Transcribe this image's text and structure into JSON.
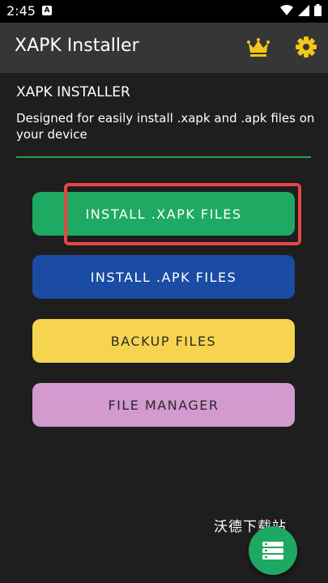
{
  "status_bar": {
    "time": "2:45",
    "notification_icon": "a-badge-icon",
    "icons": [
      "wifi-icon",
      "signal-icon",
      "battery-icon"
    ]
  },
  "app_bar": {
    "title": "XAPK Installer",
    "crown_icon": "crown-icon",
    "settings_icon": "gear-icon"
  },
  "main": {
    "heading": "XAPK INSTALLER",
    "description": "Designed for easily install .xapk and .apk files on your device",
    "buttons": [
      {
        "label": "INSTALL .XAPK FILES",
        "color": "#1eaa62"
      },
      {
        "label": "INSTALL .APK FILES",
        "color": "#1a4ca3"
      },
      {
        "label": "BACKUP FILES",
        "color": "#f7d44f"
      },
      {
        "label": "FILE MANAGER",
        "color": "#d39ad0"
      }
    ]
  },
  "watermark": "沃德下载站",
  "fab": {
    "icon": "list-icon"
  },
  "colors": {
    "accent_green": "#1eaa62",
    "highlight_red": "#e84545",
    "crown_gold": "#f5c518"
  }
}
